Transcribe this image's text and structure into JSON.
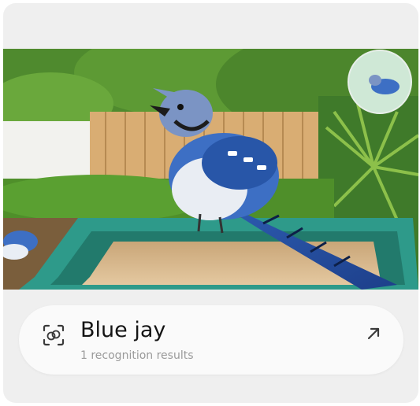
{
  "result": {
    "title": "Blue jay",
    "subtitle": "1 recognition results"
  },
  "icons": {
    "scan": "object-scan-icon",
    "open": "arrow-up-right-icon"
  },
  "colors": {
    "card_background": "#efefef",
    "pill_background": "#fafafa",
    "title_text": "#141414",
    "subtitle_text": "#9a9a9a",
    "bird_blue": "#3d6fc4"
  }
}
